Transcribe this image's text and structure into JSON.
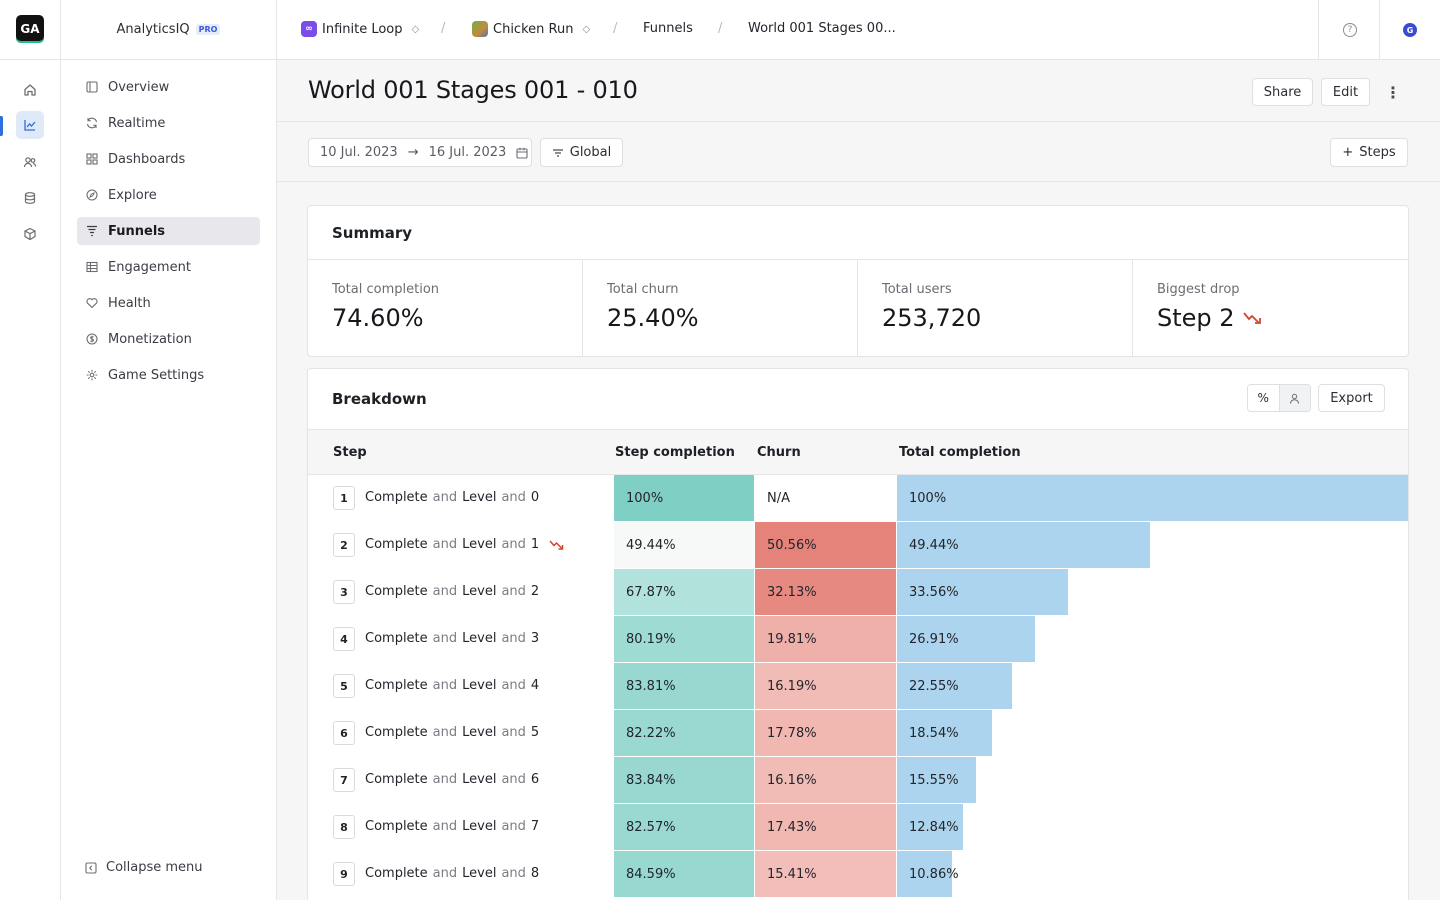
{
  "app": {
    "logo_text": "GA",
    "brand": "AnalyticsIQ",
    "badge": "PRO"
  },
  "breadcrumbs": {
    "org": {
      "badge": "∞",
      "label": "Infinite Loop"
    },
    "game": {
      "label": "Chicken Run"
    },
    "section": "Funnels",
    "page": "World 001 Stages 00..."
  },
  "topbar": {
    "help_glyph": "?",
    "avatar_initial": "G"
  },
  "sidebar": {
    "items": [
      {
        "label": "Overview",
        "icon": "overview-icon"
      },
      {
        "label": "Realtime",
        "icon": "realtime-icon"
      },
      {
        "label": "Dashboards",
        "icon": "dashboards-icon"
      },
      {
        "label": "Explore",
        "icon": "explore-icon"
      },
      {
        "label": "Funnels",
        "icon": "funnels-icon",
        "active": true
      },
      {
        "label": "Engagement",
        "icon": "engagement-icon"
      },
      {
        "label": "Health",
        "icon": "health-icon"
      },
      {
        "label": "Monetization",
        "icon": "monetization-icon"
      },
      {
        "label": "Game Settings",
        "icon": "game-settings-icon"
      }
    ],
    "collapse_label": "Collapse menu"
  },
  "header": {
    "title": "World 001 Stages 001 - 010",
    "share_label": "Share",
    "edit_label": "Edit",
    "more_glyph": "⋮"
  },
  "filters": {
    "date_from": "10 Jul. 2023",
    "date_to": "16 Jul. 2023",
    "arrow": "→",
    "scope_label": "Global",
    "steps_label": "Steps",
    "steps_plus": "+"
  },
  "summary": {
    "title": "Summary",
    "stats": [
      {
        "label": "Total completion",
        "value": "74.60%"
      },
      {
        "label": "Total churn",
        "value": "25.40%"
      },
      {
        "label": "Total users",
        "value": "253,720"
      },
      {
        "label": "Biggest drop",
        "value": "Step 2"
      }
    ]
  },
  "breakdown": {
    "title": "Breakdown",
    "toggle_percent": "%",
    "export_label": "Export",
    "columns": {
      "step": "Step",
      "step_completion": "Step completion",
      "churn": "Churn",
      "total_completion": "Total completion"
    },
    "step_word_complete": "Complete",
    "step_word_and": "and",
    "step_word_level": "Level",
    "rows": [
      {
        "no": "1",
        "level": "0",
        "step_completion": "100%",
        "churn": "N/A",
        "total": "100%",
        "total_value": 100,
        "step_value": 100,
        "churn_value": null,
        "drop": false
      },
      {
        "no": "2",
        "level": "1",
        "step_completion": "49.44%",
        "churn": "50.56%",
        "total": "49.44%",
        "total_value": 49.44,
        "step_value": 49.44,
        "churn_value": 50.56,
        "drop": true
      },
      {
        "no": "3",
        "level": "2",
        "step_completion": "67.87%",
        "churn": "32.13%",
        "total": "33.56%",
        "total_value": 33.56,
        "step_value": 67.87,
        "churn_value": 32.13,
        "drop": false
      },
      {
        "no": "4",
        "level": "3",
        "step_completion": "80.19%",
        "churn": "19.81%",
        "total": "26.91%",
        "total_value": 26.91,
        "step_value": 80.19,
        "churn_value": 19.81,
        "drop": false
      },
      {
        "no": "5",
        "level": "4",
        "step_completion": "83.81%",
        "churn": "16.19%",
        "total": "22.55%",
        "total_value": 22.55,
        "step_value": 83.81,
        "churn_value": 16.19,
        "drop": false
      },
      {
        "no": "6",
        "level": "5",
        "step_completion": "82.22%",
        "churn": "17.78%",
        "total": "18.54%",
        "total_value": 18.54,
        "step_value": 82.22,
        "churn_value": 17.78,
        "drop": false
      },
      {
        "no": "7",
        "level": "6",
        "step_completion": "83.84%",
        "churn": "16.16%",
        "total": "15.55%",
        "total_value": 15.55,
        "step_value": 83.84,
        "churn_value": 16.16,
        "drop": false
      },
      {
        "no": "8",
        "level": "7",
        "step_completion": "82.57%",
        "churn": "17.43%",
        "total": "12.84%",
        "total_value": 12.84,
        "step_value": 82.57,
        "churn_value": 17.43,
        "drop": false
      },
      {
        "no": "9",
        "level": "8",
        "step_completion": "84.59%",
        "churn": "15.41%",
        "total": "10.86%",
        "total_value": 10.86,
        "step_value": 84.59,
        "churn_value": 15.41,
        "drop": false
      }
    ]
  },
  "colors": {
    "accent": "#2f6fdd",
    "drop_red": "#d2452f",
    "total_bar": "#add4ee",
    "step_high": "#7fcfc5",
    "churn_high": "#e5837a"
  }
}
